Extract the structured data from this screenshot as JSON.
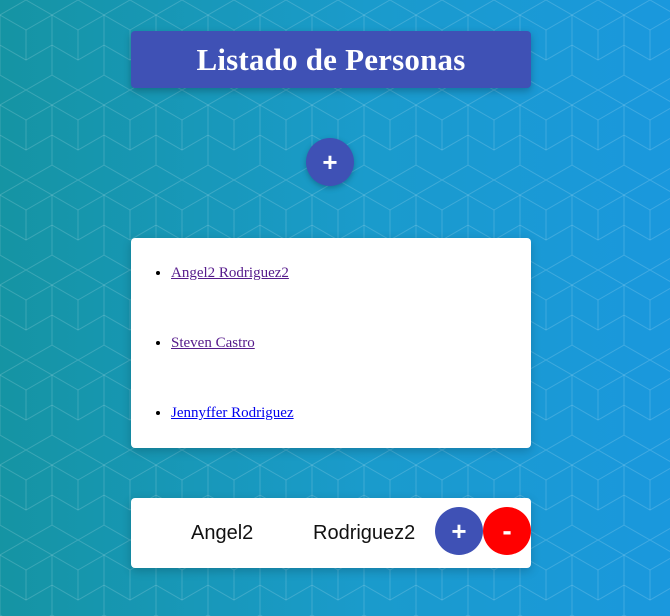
{
  "header": {
    "title": "Listado de Personas"
  },
  "add_button": {
    "label": "+"
  },
  "people": [
    {
      "name": "Angel2 Rodriguez2",
      "visited": true
    },
    {
      "name": "Steven Castro",
      "visited": true
    },
    {
      "name": "Jennyffer Rodriguez",
      "visited": false
    }
  ],
  "detail": {
    "first_name": "Angel2",
    "last_name": "Rodriguez2",
    "edit_label": "+",
    "delete_label": "-"
  },
  "colors": {
    "primary": "#3f51b5",
    "danger": "#ff0000",
    "link_visited": "#551a8b",
    "link": "#0000ee"
  }
}
